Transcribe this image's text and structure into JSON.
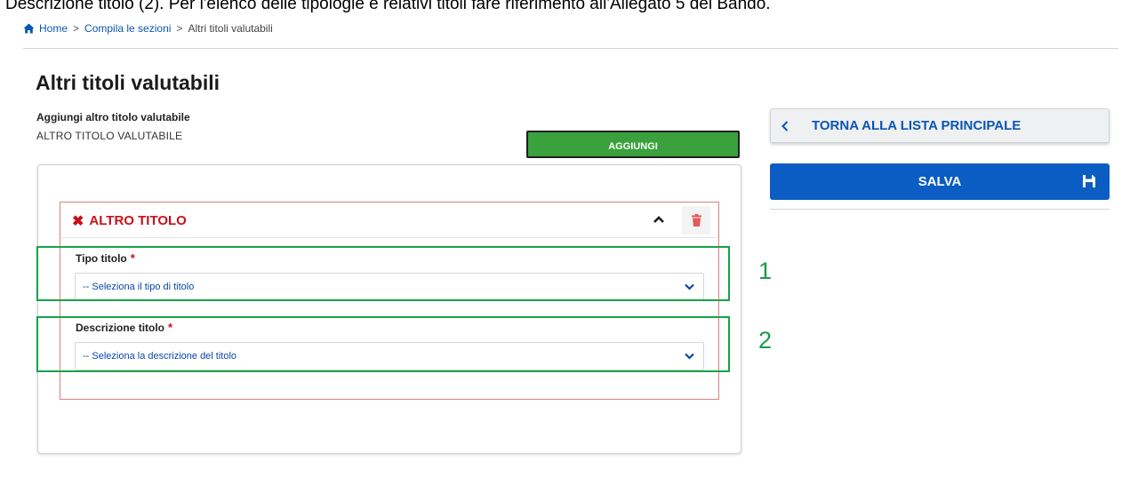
{
  "caption": "Descrizione titolo (2). Per l'elenco delle tipologie e relativi titoli fare riferimento all'Allegato 5 del Bando.",
  "breadcrumb": {
    "home": "Home",
    "separator": ">",
    "section": "Compila le sezioni",
    "current": "Altri titoli valutabili"
  },
  "page": {
    "title": "Altri titoli valutabili",
    "add_heading": "Aggiungi altro titolo valutabile",
    "add_label": "ALTRO TITOLO VALUTABILE",
    "add_button": "AGGIUNGI"
  },
  "entry": {
    "title": "ALTRO TITOLO",
    "fields": [
      {
        "label": "Tipo titolo",
        "required_marker": "*",
        "placeholder": "-- Seleziona il tipo di titolo"
      },
      {
        "label": "Descrizione titolo",
        "required_marker": "*",
        "placeholder": "-- Seleziona la descrizione del titolo"
      }
    ]
  },
  "annotations": [
    "1",
    "2"
  ],
  "sidebar": {
    "back_button": "TORNA ALLA LISTA PRINCIPALE",
    "save_button": "SALVA"
  },
  "colors": {
    "link_blue": "#0b56b3",
    "save_blue": "#0b5dc4",
    "add_green": "#3aa13c",
    "error_red": "#c8101c",
    "annotation_green": "#17a24a"
  }
}
